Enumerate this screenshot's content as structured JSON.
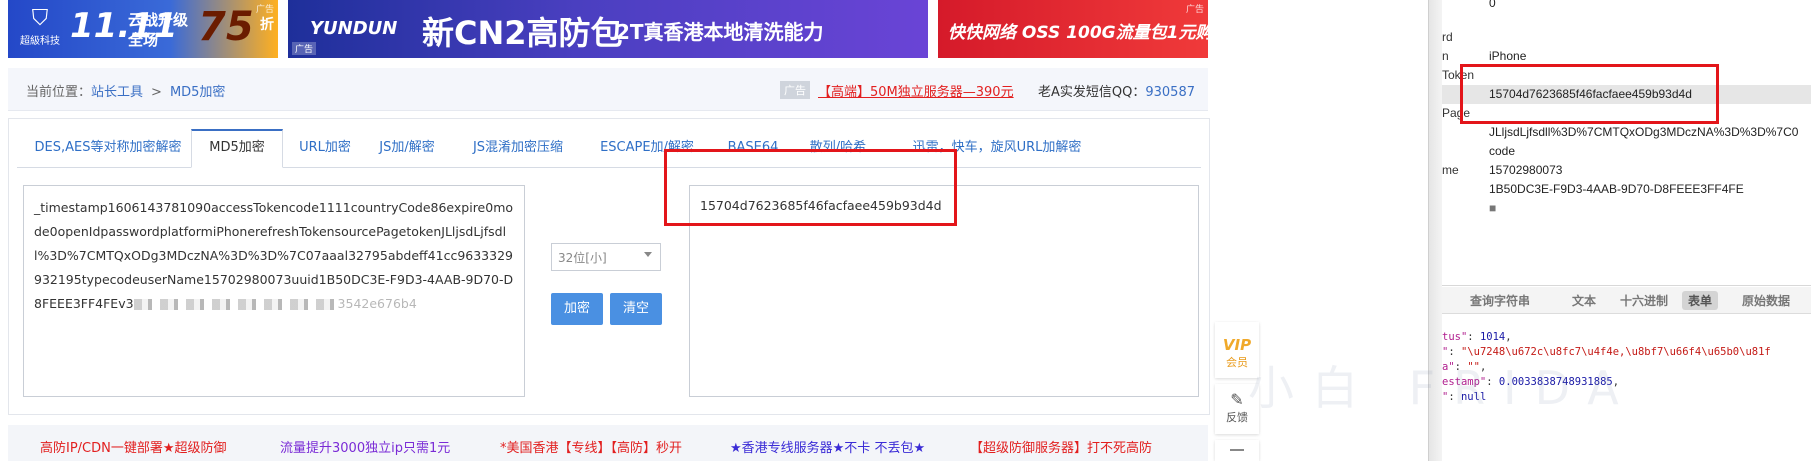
{
  "banners": [
    {
      "brand": "超級科技",
      "big": "11.11",
      "promo_line1": "云战升级",
      "promo_line2": "全场",
      "discount": "75",
      "discount_unit": "折",
      "ad_label": "广告"
    },
    {
      "logo": "YUNDUN",
      "headline": "新CN2高防包",
      "subline": "2T真香港本地清洗能力",
      "ad_label": "广告"
    },
    {
      "text": "快快网络 OSS 100G流量包1元购",
      "ad_label": "广告"
    }
  ],
  "breadcrumb": {
    "prefix": "当前位置：",
    "home": "站长工具",
    "separator": ">",
    "current": "MD5加密"
  },
  "top_ad": {
    "tag": "广告",
    "text": "【高端】50M独立服务器—390元"
  },
  "contact": {
    "label": "老A实发短信QQ：",
    "qq": "930587"
  },
  "tabs": [
    {
      "label": "DES,AES等对称加密解密",
      "active": false
    },
    {
      "label": "MD5加密",
      "active": true
    },
    {
      "label": "URL加密",
      "active": false
    },
    {
      "label": "JS加/解密",
      "active": false
    },
    {
      "label": "JS混淆加密压缩",
      "active": false
    },
    {
      "label": "ESCAPE加/解密",
      "active": false
    },
    {
      "label": "BASE64",
      "active": false
    },
    {
      "label": "散列/哈希",
      "active": false
    },
    {
      "label": "迅雷，快车，旋风URL加解密",
      "active": false
    }
  ],
  "input": {
    "text": "_timestamp1606143781090accessTokencode1111countryCode86expire0mode0openIdpasswordplatformiPhonerefreshTokensourcePagetokenJLljsdLjfsdll%3D%7CMTQxODg3MDczNA%3D%3D%7C07aaal32795abdeff41cc9633329932195typecodeuserName15702980073uuid1B50DC3E-F9D3-4AAB-9D70-D8FEEE3FF4FEv3",
    "text_tail": "3542e676b4"
  },
  "select": {
    "value": "32位[小]"
  },
  "buttons": {
    "encrypt": "加密",
    "clear": "清空"
  },
  "output": {
    "text": "15704d7623685f46facfaee459b93d4d"
  },
  "bottom_links": [
    {
      "text": "高防IP/CDN一键部署★超级防御",
      "color": "#e21f1f"
    },
    {
      "text": "流量提升3000独立ip只需1元",
      "color": "#7a2bd6"
    },
    {
      "text": "*美国香港【专线】【高防】秒开",
      "color": "#e21f1f"
    },
    {
      "text": "★香港专线服务器★不卡 不丢包★",
      "color": "#3a2bd6"
    },
    {
      "text": "【超级防御服务器】打不死高防",
      "color": "#e21f1f"
    }
  ],
  "side_widgets": {
    "vip_badge": "VIP",
    "vip_label": "会员",
    "feedback_label": "反馈"
  },
  "devtools": {
    "rows": [
      {
        "key": "",
        "value": "0"
      },
      {
        "key": "rd",
        "value": ""
      },
      {
        "key": "n",
        "value": "iPhone"
      },
      {
        "key": "Token",
        "value": ""
      },
      {
        "key": "",
        "value": "15704d7623685f46facfaee459b93d4d"
      },
      {
        "key": "Page",
        "value": ""
      },
      {
        "key": "",
        "value": "JLljsdLjfsdll%3D%7CMTQxODg3MDczNA%3D%3D%7C0"
      },
      {
        "key": "",
        "value": "code"
      },
      {
        "key": "me",
        "value": "15702980073"
      },
      {
        "key": "",
        "value": "1B50DC3E-F9D3-4AAB-9D70-D8FEEE3FF4FE"
      },
      {
        "key": "",
        "value": "■"
      }
    ],
    "tabs": [
      "查询字符串",
      "文本",
      "十六进制",
      "表单",
      "原始数据"
    ],
    "active_tab": "表单",
    "json": {
      "line1_key": "tus\"",
      "line1_val": "1014",
      "line2_key": "\"",
      "line2_val": "\"\\u7248\\u672c\\u8fc7\\u4f4e,\\u8bf7\\u66f4\\u65b0\\u81f",
      "line3_key": "a\"",
      "line3_val": "\"\"",
      "line4_key": "estamp\"",
      "line4_val": "0.0033838748931885",
      "line5_key": "\"",
      "line5_val": "null"
    }
  },
  "watermark": "小白 FRIDA"
}
